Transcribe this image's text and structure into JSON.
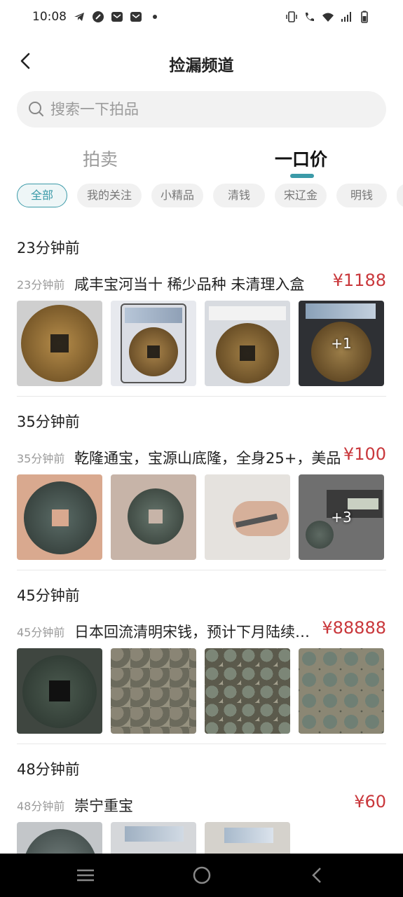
{
  "status_bar": {
    "time": "10:08"
  },
  "header": {
    "title": "捡漏频道"
  },
  "search": {
    "placeholder": "搜索一下拍品"
  },
  "tabs": [
    {
      "label": "拍卖"
    },
    {
      "label": "一口价"
    }
  ],
  "chips": [
    "全部",
    "我的关注",
    "小精品",
    "清钱",
    "宋辽金",
    "明钱"
  ],
  "items": [
    {
      "ago": "23分钟前",
      "desc": "咸丰宝河当十 稀少品种 未清理入盒",
      "price": "¥1188",
      "more": "+1"
    },
    {
      "ago": "35分钟前",
      "desc": "乾隆通宝，宝源山底隆，全身25+，美品",
      "price": "¥100",
      "more": "+3"
    },
    {
      "ago": "45分钟前",
      "desc": "日本回流清明宋钱，预计下月陆续到货",
      "price": "¥88888",
      "more": ""
    },
    {
      "ago": "48分钟前",
      "desc": "崇宁重宝",
      "price": "¥60",
      "more": ""
    }
  ],
  "colors": {
    "accent": "#3b9aa8",
    "price": "#c9373b"
  }
}
